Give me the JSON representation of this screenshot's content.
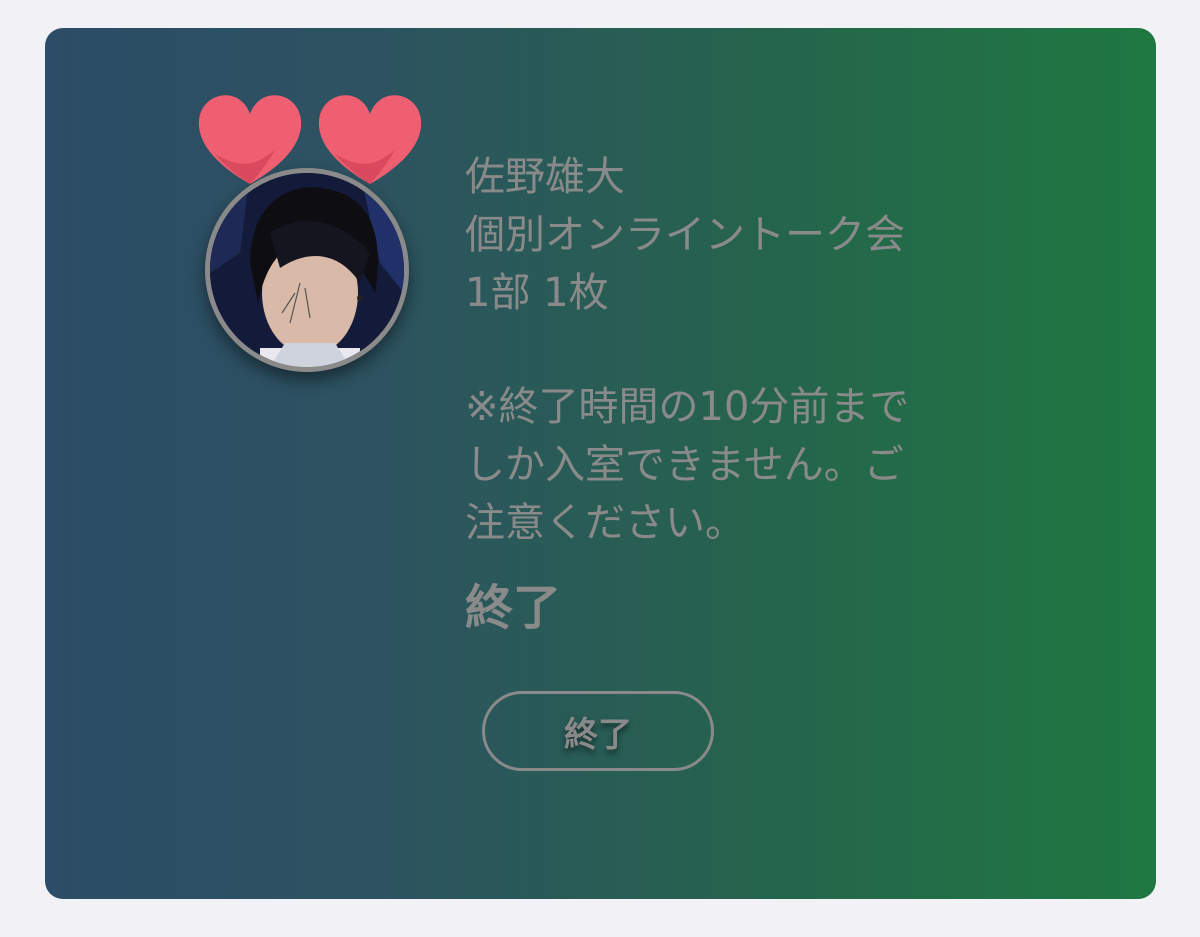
{
  "event": {
    "artist_name": "佐野雄大",
    "event_title": "個別オンライントーク会",
    "ticket_info": "1部 1枚"
  },
  "notice": {
    "line1": "※終了時間の10分前まで",
    "line2": "しか入室できません。ご",
    "line3": "注意ください。"
  },
  "status": {
    "label": "終了"
  },
  "action": {
    "button_label": "終了"
  },
  "colors": {
    "card_gradient_start": "#2c4c67",
    "card_gradient_end": "#1f7841",
    "heart": "#ef5f72",
    "text": "#8a8a8a",
    "page_background": "#f2f2f6"
  },
  "icons": {
    "heart": "heart-icon"
  }
}
